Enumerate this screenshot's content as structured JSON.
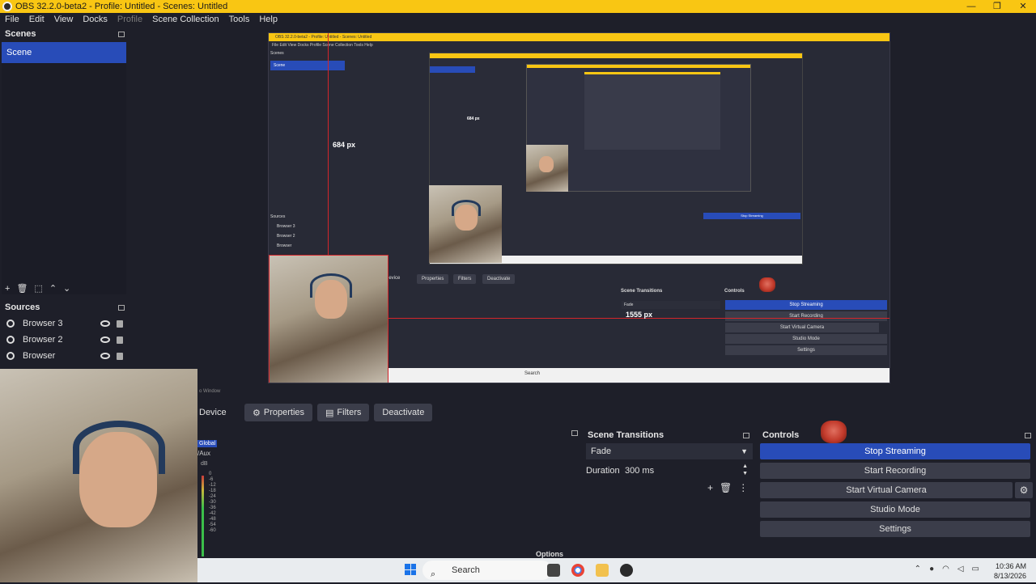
{
  "window": {
    "title": "OBS 32.2.0-beta2 - Profile: Untitled - Scenes: Untitled",
    "min": "—",
    "max": "❐",
    "close": "✕"
  },
  "menu": [
    "File",
    "Edit",
    "View",
    "Docks",
    "Profile",
    "Scene Collection",
    "Tools",
    "Help"
  ],
  "scenes": {
    "title": "Scenes",
    "items": [
      "Scene"
    ],
    "toolbar": [
      "+",
      "🗑",
      "⬚",
      "⌃",
      "⌄"
    ]
  },
  "sources": {
    "title": "Sources",
    "items": [
      "Browser 3",
      "Browser 2",
      "Browser"
    ]
  },
  "preview": {
    "inner_title": "OBS 32.2.0-beta2 - Profile: Untitled - Scenes: Untitled",
    "inner_menu": "File  Edit  View  Docks  Profile  Scene Collection  Tools  Help",
    "inner_scenes": "Scenes",
    "inner_scene": "Scene",
    "inner_sources": "Sources",
    "inner_sources_items": [
      "Browser 3",
      "Browser 2",
      "Browser"
    ],
    "measure_v": "684 px",
    "measure_v_small": "684 px",
    "measure_h": "1555 px",
    "inner_device": "Device",
    "inner_properties": "Properties",
    "inner_filters": "Filters",
    "inner_deactivate": "Deactivate",
    "inner_transitions": "Scene Transitions",
    "inner_fade": "Fade",
    "inner_controls": "Controls",
    "inner_stop": "Stop Streaming",
    "inner_rec": "Start Recording",
    "inner_vcam": "Start Virtual Camera",
    "inner_studio": "Studio Mode",
    "inner_settings": "Settings",
    "inner_search": "Search"
  },
  "context": {
    "device": "Device",
    "properties": "Properties",
    "filters": "Filters",
    "deactivate": "Deactivate",
    "window_label": "o Window"
  },
  "mixer": {
    "global": "Global",
    "aux": "/Aux",
    "db": "dB",
    "scale": [
      "0",
      "-6",
      "-12",
      "-18",
      "-24",
      "-30",
      "-36",
      "-42",
      "-48",
      "-54",
      "-60"
    ],
    "options": "Options"
  },
  "transitions": {
    "title": "Scene Transitions",
    "selected": "Fade",
    "duration_label": "Duration",
    "duration_value": "300 ms"
  },
  "controls": {
    "title": "Controls",
    "stop_streaming": "Stop Streaming",
    "start_recording": "Start Recording",
    "start_virtual_camera": "Start Virtual Camera",
    "studio_mode": "Studio Mode",
    "settings": "Settings"
  },
  "taskbar": {
    "search": "Search",
    "time": "10:36 AM",
    "date": "8/13/2026"
  },
  "colors": {
    "accent": "#284cb8",
    "titlebar": "#f9c613",
    "panel": "#1e1f29",
    "measure": "#d3262b"
  }
}
